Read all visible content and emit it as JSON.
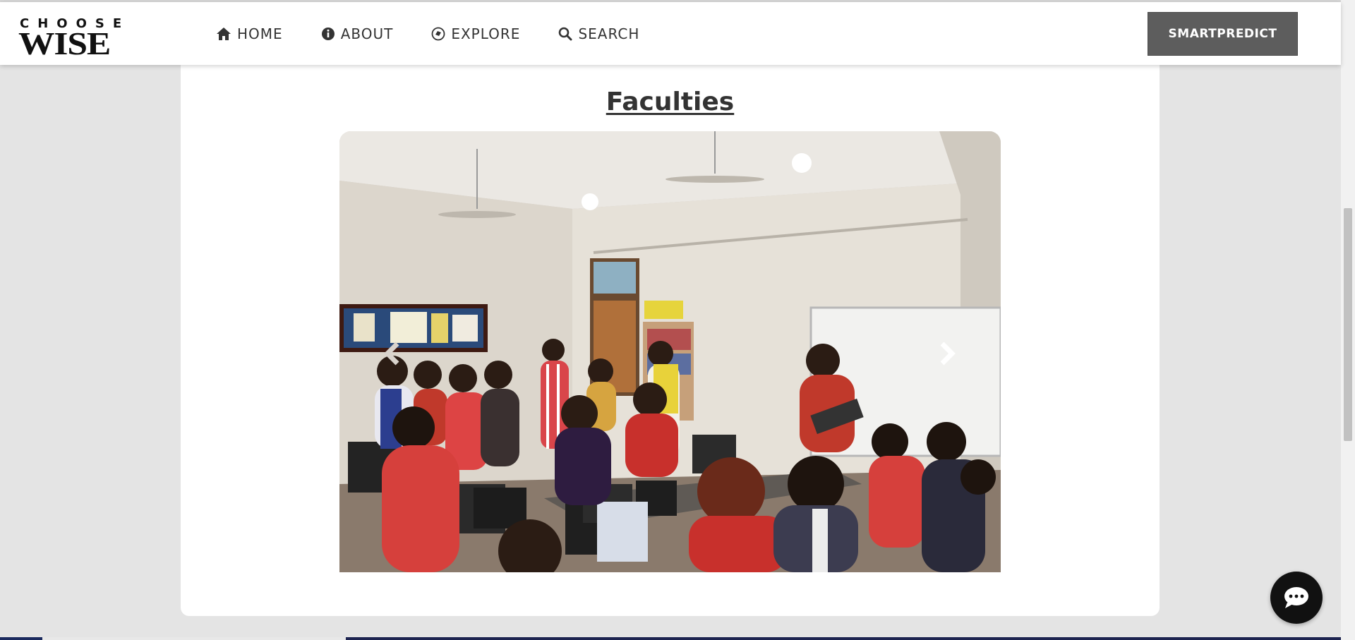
{
  "header": {
    "logo": {
      "top": "CHOOSE",
      "bottom": "WISE"
    },
    "nav": [
      {
        "label": "HOME",
        "icon": "home-icon"
      },
      {
        "label": "ABOUT",
        "icon": "info-icon"
      },
      {
        "label": "EXPLORE",
        "icon": "compass-icon"
      },
      {
        "label": "SEARCH",
        "icon": "search-icon"
      }
    ],
    "cta_label": "SMARTPREDICT"
  },
  "main": {
    "section_title": "Faculties",
    "carousel": {
      "prev_icon": "chevron-left-icon",
      "next_icon": "chevron-right-icon",
      "image_alt": "Faculty training session in a computer lab"
    }
  },
  "chat": {
    "icon": "chat-icon"
  },
  "colors": {
    "page_bg": "#e4e4e4",
    "card_bg": "#ffffff",
    "cta_bg": "#5d5d5d",
    "chat_bg": "#111111",
    "title": "#333333"
  }
}
